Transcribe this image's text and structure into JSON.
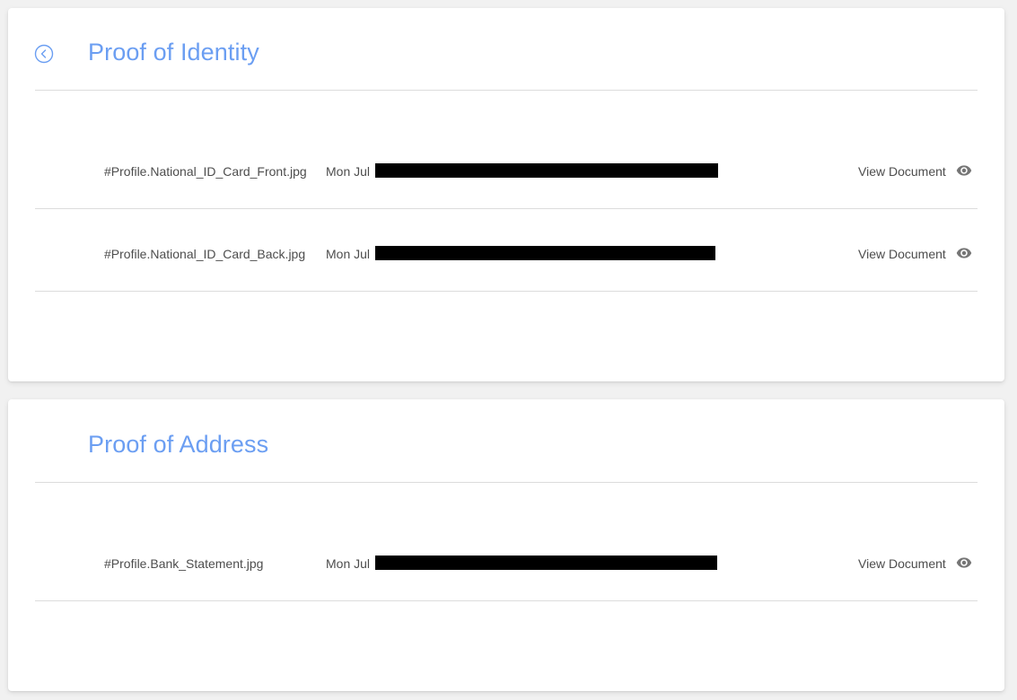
{
  "identity": {
    "title": "Proof of Identity",
    "documents": [
      {
        "file_name": "#Profile.National_ID_Card_Front.jpg",
        "date_prefix": "Mon Jul",
        "action_label": "View Document",
        "icon": "eye-icon"
      },
      {
        "file_name": "#Profile.National_ID_Card_Back.jpg",
        "date_prefix": "Mon Jul",
        "action_label": "View Document",
        "icon": "eye-icon"
      }
    ]
  },
  "address": {
    "title": "Proof of Address",
    "documents": [
      {
        "file_name": "#Profile.Bank_Statement.jpg",
        "date_prefix": "Mon Jul",
        "action_label": "View Document",
        "icon": "eye-icon"
      }
    ]
  },
  "icons": {
    "back": "chevron-left-circle-icon",
    "view": "eye-icon"
  },
  "colors": {
    "title": "#6b9ef2",
    "text": "#4d4d4d",
    "icon": "#757575",
    "divider": "#dcdcdc",
    "redaction": "#000000"
  }
}
